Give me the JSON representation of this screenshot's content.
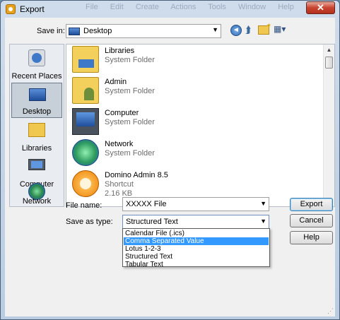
{
  "window": {
    "title": "Export",
    "close_glyph": "✕",
    "ghost_menu": [
      "File",
      "Edit",
      "Create",
      "Actions",
      "Tools",
      "Window",
      "Help"
    ]
  },
  "toolbar": {
    "save_in_label": "Save in:",
    "save_in_value": "Desktop",
    "back_icon": "back-arrow-icon",
    "up_icon": "up-folder-icon",
    "new_folder_icon": "new-folder-icon",
    "views_icon": "views-menu-icon"
  },
  "places": [
    {
      "label": "Recent Places",
      "icon": "recent-places-icon",
      "selected": false
    },
    {
      "label": "Desktop",
      "icon": "desktop-icon",
      "selected": true
    },
    {
      "label": "Libraries",
      "icon": "libraries-icon",
      "selected": false
    },
    {
      "label": "Computer",
      "icon": "computer-icon",
      "selected": false
    },
    {
      "label": "Network",
      "icon": "network-icon",
      "selected": false
    }
  ],
  "files": [
    {
      "name": "Libraries",
      "type": "System Folder",
      "size": "",
      "icon": "libraries-folder-icon"
    },
    {
      "name": "Admin",
      "type": "System Folder",
      "size": "",
      "icon": "user-folder-icon"
    },
    {
      "name": "Computer",
      "type": "System Folder",
      "size": "",
      "icon": "computer-icon"
    },
    {
      "name": "Network",
      "type": "System Folder",
      "size": "",
      "icon": "network-icon"
    },
    {
      "name": "Domino Admin 8.5",
      "type": "Shortcut",
      "size": "2.16 KB",
      "icon": "domino-admin-icon"
    }
  ],
  "form": {
    "file_name_label": "File name:",
    "file_name_value": "XXXXX File",
    "save_as_type_label": "Save as type:",
    "save_as_type_value": "Structured Text",
    "type_options": [
      {
        "label": "Calendar File (.ics)",
        "selected": false
      },
      {
        "label": "Comma Separated Value",
        "selected": true
      },
      {
        "label": "Lotus 1-2-3",
        "selected": false
      },
      {
        "label": "Structured Text",
        "selected": false
      },
      {
        "label": "Tabular Text",
        "selected": false
      }
    ]
  },
  "buttons": {
    "export": "Export",
    "cancel": "Cancel",
    "help": "Help"
  },
  "colors": {
    "selection": "#3399ff",
    "close_button": "#c8442f",
    "titlebar": "#cfdceb"
  }
}
